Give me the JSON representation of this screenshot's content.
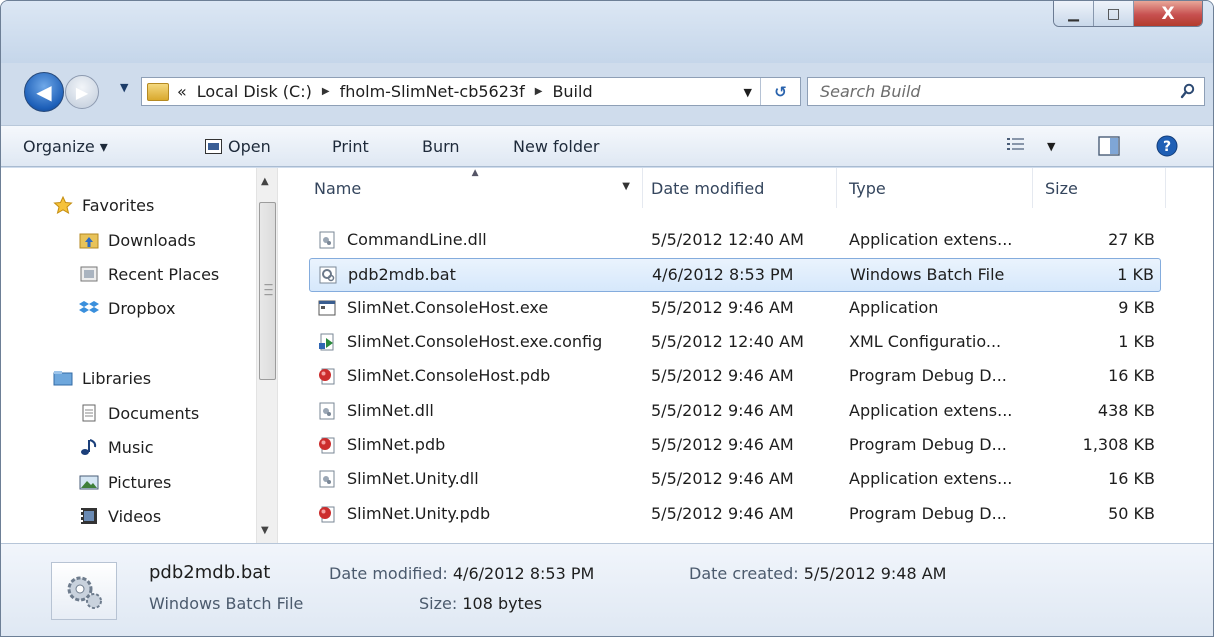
{
  "window": {
    "minimize": "▁",
    "maximize": "□",
    "close": "X"
  },
  "address": {
    "overflow": "«",
    "crumbs": [
      "Local Disk (C:)",
      "fholm-SlimNet-cb5623f",
      "Build"
    ]
  },
  "search": {
    "placeholder": "Search Build"
  },
  "toolbar": {
    "organize": "Organize ▾",
    "open": "Open",
    "print": "Print",
    "burn": "Burn",
    "new_folder": "New folder"
  },
  "nav": {
    "favorites": "Favorites",
    "downloads": "Downloads",
    "recent_places": "Recent Places",
    "dropbox": "Dropbox",
    "libraries": "Libraries",
    "documents": "Documents",
    "music": "Music",
    "pictures": "Pictures",
    "videos": "Videos"
  },
  "columns": {
    "name": "Name",
    "date_modified": "Date modified",
    "type": "Type",
    "size": "Size"
  },
  "files": [
    {
      "name": "CommandLine.dll",
      "date": "5/5/2012 12:40 AM",
      "type": "Application extens...",
      "size": "27 KB",
      "icon": "dll-icon"
    },
    {
      "name": "pdb2mdb.bat",
      "date": "4/6/2012 8:53 PM",
      "type": "Windows Batch File",
      "size": "1 KB",
      "icon": "batch-file-icon"
    },
    {
      "name": "SlimNet.ConsoleHost.exe",
      "date": "5/5/2012 9:46 AM",
      "type": "Application",
      "size": "9 KB",
      "icon": "exe-icon"
    },
    {
      "name": "SlimNet.ConsoleHost.exe.config",
      "date": "5/5/2012 12:40 AM",
      "type": "XML Configuratio...",
      "size": "1 KB",
      "icon": "config-icon"
    },
    {
      "name": "SlimNet.ConsoleHost.pdb",
      "date": "5/5/2012 9:46 AM",
      "type": "Program Debug D...",
      "size": "16 KB",
      "icon": "pdb-icon"
    },
    {
      "name": "SlimNet.dll",
      "date": "5/5/2012 9:46 AM",
      "type": "Application extens...",
      "size": "438 KB",
      "icon": "dll-icon"
    },
    {
      "name": "SlimNet.pdb",
      "date": "5/5/2012 9:46 AM",
      "type": "Program Debug D...",
      "size": "1,308 KB",
      "icon": "pdb-icon"
    },
    {
      "name": "SlimNet.Unity.dll",
      "date": "5/5/2012 9:46 AM",
      "type": "Application extens...",
      "size": "16 KB",
      "icon": "dll-icon"
    },
    {
      "name": "SlimNet.Unity.pdb",
      "date": "5/5/2012 9:46 AM",
      "type": "Program Debug D...",
      "size": "50 KB",
      "icon": "pdb-icon"
    }
  ],
  "details": {
    "name": "pdb2mdb.bat",
    "type": "Windows Batch File",
    "date_modified_label": "Date modified:",
    "date_modified": "4/6/2012 8:53 PM",
    "size_label": "Size:",
    "size": "108 bytes",
    "date_created_label": "Date created:",
    "date_created": "5/5/2012 9:48 AM"
  }
}
